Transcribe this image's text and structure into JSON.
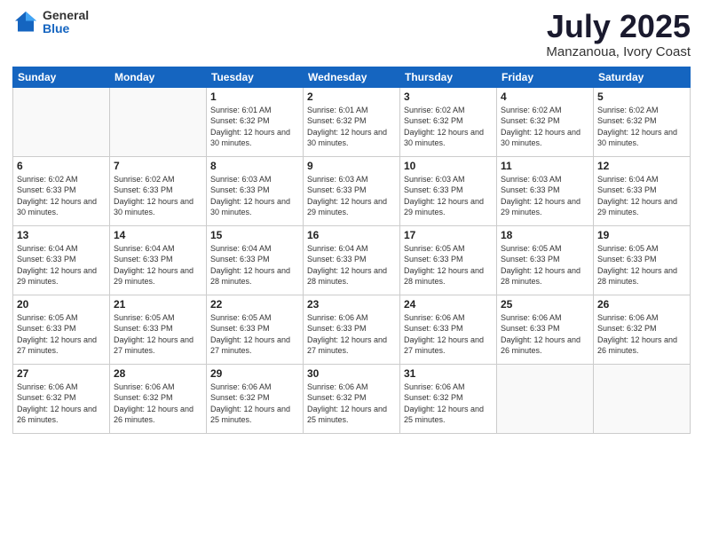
{
  "logo": {
    "general": "General",
    "blue": "Blue"
  },
  "title": "July 2025",
  "location": "Manzanoua, Ivory Coast",
  "weekdays": [
    "Sunday",
    "Monday",
    "Tuesday",
    "Wednesday",
    "Thursday",
    "Friday",
    "Saturday"
  ],
  "weeks": [
    [
      {
        "day": "",
        "info": ""
      },
      {
        "day": "",
        "info": ""
      },
      {
        "day": "1",
        "info": "Sunrise: 6:01 AM\nSunset: 6:32 PM\nDaylight: 12 hours\nand 30 minutes."
      },
      {
        "day": "2",
        "info": "Sunrise: 6:01 AM\nSunset: 6:32 PM\nDaylight: 12 hours\nand 30 minutes."
      },
      {
        "day": "3",
        "info": "Sunrise: 6:02 AM\nSunset: 6:32 PM\nDaylight: 12 hours\nand 30 minutes."
      },
      {
        "day": "4",
        "info": "Sunrise: 6:02 AM\nSunset: 6:32 PM\nDaylight: 12 hours\nand 30 minutes."
      },
      {
        "day": "5",
        "info": "Sunrise: 6:02 AM\nSunset: 6:32 PM\nDaylight: 12 hours\nand 30 minutes."
      }
    ],
    [
      {
        "day": "6",
        "info": "Sunrise: 6:02 AM\nSunset: 6:33 PM\nDaylight: 12 hours\nand 30 minutes."
      },
      {
        "day": "7",
        "info": "Sunrise: 6:02 AM\nSunset: 6:33 PM\nDaylight: 12 hours\nand 30 minutes."
      },
      {
        "day": "8",
        "info": "Sunrise: 6:03 AM\nSunset: 6:33 PM\nDaylight: 12 hours\nand 30 minutes."
      },
      {
        "day": "9",
        "info": "Sunrise: 6:03 AM\nSunset: 6:33 PM\nDaylight: 12 hours\nand 29 minutes."
      },
      {
        "day": "10",
        "info": "Sunrise: 6:03 AM\nSunset: 6:33 PM\nDaylight: 12 hours\nand 29 minutes."
      },
      {
        "day": "11",
        "info": "Sunrise: 6:03 AM\nSunset: 6:33 PM\nDaylight: 12 hours\nand 29 minutes."
      },
      {
        "day": "12",
        "info": "Sunrise: 6:04 AM\nSunset: 6:33 PM\nDaylight: 12 hours\nand 29 minutes."
      }
    ],
    [
      {
        "day": "13",
        "info": "Sunrise: 6:04 AM\nSunset: 6:33 PM\nDaylight: 12 hours\nand 29 minutes."
      },
      {
        "day": "14",
        "info": "Sunrise: 6:04 AM\nSunset: 6:33 PM\nDaylight: 12 hours\nand 29 minutes."
      },
      {
        "day": "15",
        "info": "Sunrise: 6:04 AM\nSunset: 6:33 PM\nDaylight: 12 hours\nand 28 minutes."
      },
      {
        "day": "16",
        "info": "Sunrise: 6:04 AM\nSunset: 6:33 PM\nDaylight: 12 hours\nand 28 minutes."
      },
      {
        "day": "17",
        "info": "Sunrise: 6:05 AM\nSunset: 6:33 PM\nDaylight: 12 hours\nand 28 minutes."
      },
      {
        "day": "18",
        "info": "Sunrise: 6:05 AM\nSunset: 6:33 PM\nDaylight: 12 hours\nand 28 minutes."
      },
      {
        "day": "19",
        "info": "Sunrise: 6:05 AM\nSunset: 6:33 PM\nDaylight: 12 hours\nand 28 minutes."
      }
    ],
    [
      {
        "day": "20",
        "info": "Sunrise: 6:05 AM\nSunset: 6:33 PM\nDaylight: 12 hours\nand 27 minutes."
      },
      {
        "day": "21",
        "info": "Sunrise: 6:05 AM\nSunset: 6:33 PM\nDaylight: 12 hours\nand 27 minutes."
      },
      {
        "day": "22",
        "info": "Sunrise: 6:05 AM\nSunset: 6:33 PM\nDaylight: 12 hours\nand 27 minutes."
      },
      {
        "day": "23",
        "info": "Sunrise: 6:06 AM\nSunset: 6:33 PM\nDaylight: 12 hours\nand 27 minutes."
      },
      {
        "day": "24",
        "info": "Sunrise: 6:06 AM\nSunset: 6:33 PM\nDaylight: 12 hours\nand 27 minutes."
      },
      {
        "day": "25",
        "info": "Sunrise: 6:06 AM\nSunset: 6:33 PM\nDaylight: 12 hours\nand 26 minutes."
      },
      {
        "day": "26",
        "info": "Sunrise: 6:06 AM\nSunset: 6:32 PM\nDaylight: 12 hours\nand 26 minutes."
      }
    ],
    [
      {
        "day": "27",
        "info": "Sunrise: 6:06 AM\nSunset: 6:32 PM\nDaylight: 12 hours\nand 26 minutes."
      },
      {
        "day": "28",
        "info": "Sunrise: 6:06 AM\nSunset: 6:32 PM\nDaylight: 12 hours\nand 26 minutes."
      },
      {
        "day": "29",
        "info": "Sunrise: 6:06 AM\nSunset: 6:32 PM\nDaylight: 12 hours\nand 25 minutes."
      },
      {
        "day": "30",
        "info": "Sunrise: 6:06 AM\nSunset: 6:32 PM\nDaylight: 12 hours\nand 25 minutes."
      },
      {
        "day": "31",
        "info": "Sunrise: 6:06 AM\nSunset: 6:32 PM\nDaylight: 12 hours\nand 25 minutes."
      },
      {
        "day": "",
        "info": ""
      },
      {
        "day": "",
        "info": ""
      }
    ]
  ]
}
